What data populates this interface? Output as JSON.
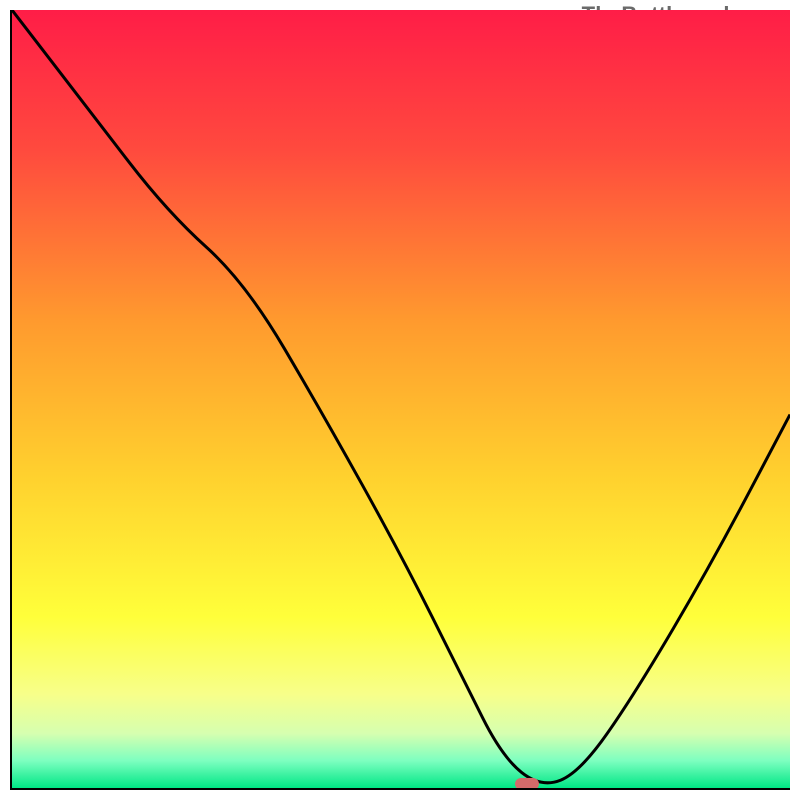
{
  "watermark": "TheBottleneck.com",
  "chart_data": {
    "type": "line",
    "title": "",
    "xlabel": "",
    "ylabel": "",
    "xlim": [
      0,
      100
    ],
    "ylim": [
      0,
      100
    ],
    "grid": false,
    "legend": false,
    "background_gradient_stops": [
      {
        "pct": 0,
        "color": "#ff1d47"
      },
      {
        "pct": 18,
        "color": "#ff4a3e"
      },
      {
        "pct": 40,
        "color": "#ff9a2e"
      },
      {
        "pct": 60,
        "color": "#ffd12e"
      },
      {
        "pct": 78,
        "color": "#ffff3a"
      },
      {
        "pct": 88,
        "color": "#f7ff8a"
      },
      {
        "pct": 93,
        "color": "#d6ffb0"
      },
      {
        "pct": 96.5,
        "color": "#7dffc0"
      },
      {
        "pct": 100,
        "color": "#00e685"
      }
    ],
    "series": [
      {
        "name": "bottleneck-curve",
        "x": [
          0,
          10,
          20,
          30,
          40,
          50,
          58,
          63,
          68,
          73,
          80,
          90,
          100
        ],
        "y": [
          100,
          87,
          74,
          65,
          48,
          30,
          14,
          4,
          0,
          2,
          12,
          29,
          48
        ]
      }
    ],
    "marker": {
      "name": "optimum-marker",
      "x": 66,
      "y": 0.8,
      "color": "#d46a6a"
    }
  }
}
